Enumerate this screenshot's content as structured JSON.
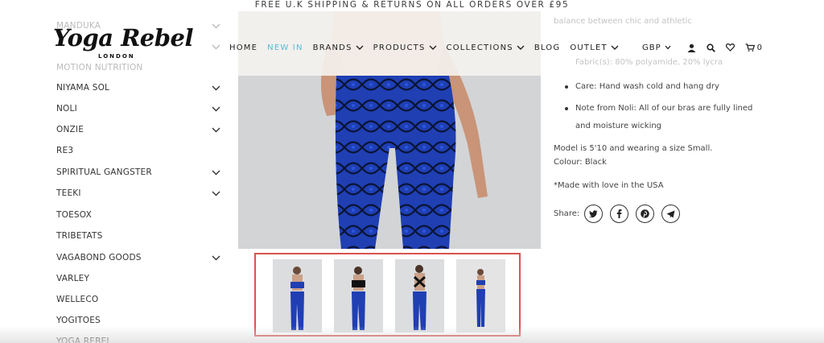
{
  "promo": "FREE U.K SHIPPING & RETURNS ON ALL ORDERS OVER £95",
  "logo": {
    "script": "Yoga Rebel",
    "sub": "LONDON"
  },
  "nav": [
    {
      "label": "HOME",
      "has_dropdown": false,
      "active": false
    },
    {
      "label": "NEW IN",
      "has_dropdown": false,
      "active": true
    },
    {
      "label": "BRANDS",
      "has_dropdown": true,
      "active": false
    },
    {
      "label": "PRODUCTS",
      "has_dropdown": true,
      "active": false
    },
    {
      "label": "COLLECTIONS",
      "has_dropdown": true,
      "active": false
    },
    {
      "label": "BLOG",
      "has_dropdown": false,
      "active": false
    },
    {
      "label": "OUTLET",
      "has_dropdown": true,
      "active": false
    }
  ],
  "utility": {
    "currency": "GBP",
    "cart_count": "0",
    "icons": [
      "user-icon",
      "search-icon",
      "heart-icon",
      "cart-icon"
    ]
  },
  "sidebar": {
    "items": [
      {
        "label": "MANDUKA",
        "has_chevron": true,
        "faded": true
      },
      {
        "label": "",
        "has_chevron": true,
        "faded": true
      },
      {
        "label": "MOTION NUTRITION",
        "has_chevron": false,
        "faded": true
      },
      {
        "label": "NIYAMA SOL",
        "has_chevron": true,
        "faded": false
      },
      {
        "label": "NOLI",
        "has_chevron": true,
        "faded": false
      },
      {
        "label": "ONZIE",
        "has_chevron": true,
        "faded": false
      },
      {
        "label": "RE3",
        "has_chevron": false,
        "faded": false
      },
      {
        "label": "SPIRITUAL GANGSTER",
        "has_chevron": true,
        "faded": false
      },
      {
        "label": "TEEKI",
        "has_chevron": true,
        "faded": false
      },
      {
        "label": "TOESOX",
        "has_chevron": false,
        "faded": false
      },
      {
        "label": "TRIBETATS",
        "has_chevron": false,
        "faded": false
      },
      {
        "label": "VAGABOND GOODS",
        "has_chevron": true,
        "faded": false
      },
      {
        "label": "VARLEY",
        "has_chevron": false,
        "faded": false
      },
      {
        "label": "WELLECO",
        "has_chevron": false,
        "faded": false
      },
      {
        "label": "YOGITOES",
        "has_chevron": false,
        "faded": false
      },
      {
        "label": "YOGA REBEL",
        "has_chevron": false,
        "faded": false
      }
    ]
  },
  "product": {
    "faded_lines": [
      "balance between chic and athletic",
      "Fabric(s): 80% polyamide, 20% lycra"
    ],
    "bullets": [
      "Care: Hand wash cold and hang dry",
      "Note from Noli: All of our bras are fully lined and moisture wicking"
    ],
    "model_line1": "Model is 5'10 and wearing a size Small.",
    "model_line2": "Colour: Black",
    "made": "*Made with love in the USA",
    "share_label": "Share:",
    "share_icons": [
      "twitter-icon",
      "facebook-icon",
      "pinterest-icon",
      "email-icon"
    ]
  },
  "colors": {
    "accent": "#5ab9d6",
    "highlight_border": "#d9534f",
    "legging_blue": "#1f3fb3"
  }
}
